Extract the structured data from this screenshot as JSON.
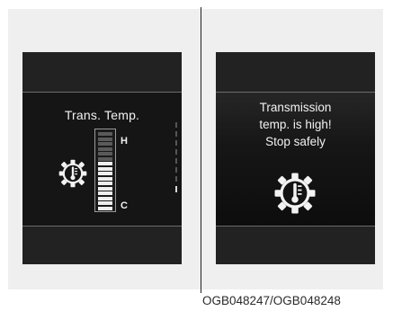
{
  "left_display": {
    "title": "Trans. Temp.",
    "gauge": {
      "high_label": "H",
      "low_label": "C",
      "total_segments": 16,
      "lit_segments": 10
    }
  },
  "right_display": {
    "warning_lines": [
      "Transmission",
      "temp. is high!",
      "Stop safely"
    ]
  },
  "caption": "OGB048247/OGB048248",
  "icons": {
    "gauge_icon": "transmission-temperature-gear-icon",
    "warning_icon": "transmission-temperature-gear-icon"
  }
}
